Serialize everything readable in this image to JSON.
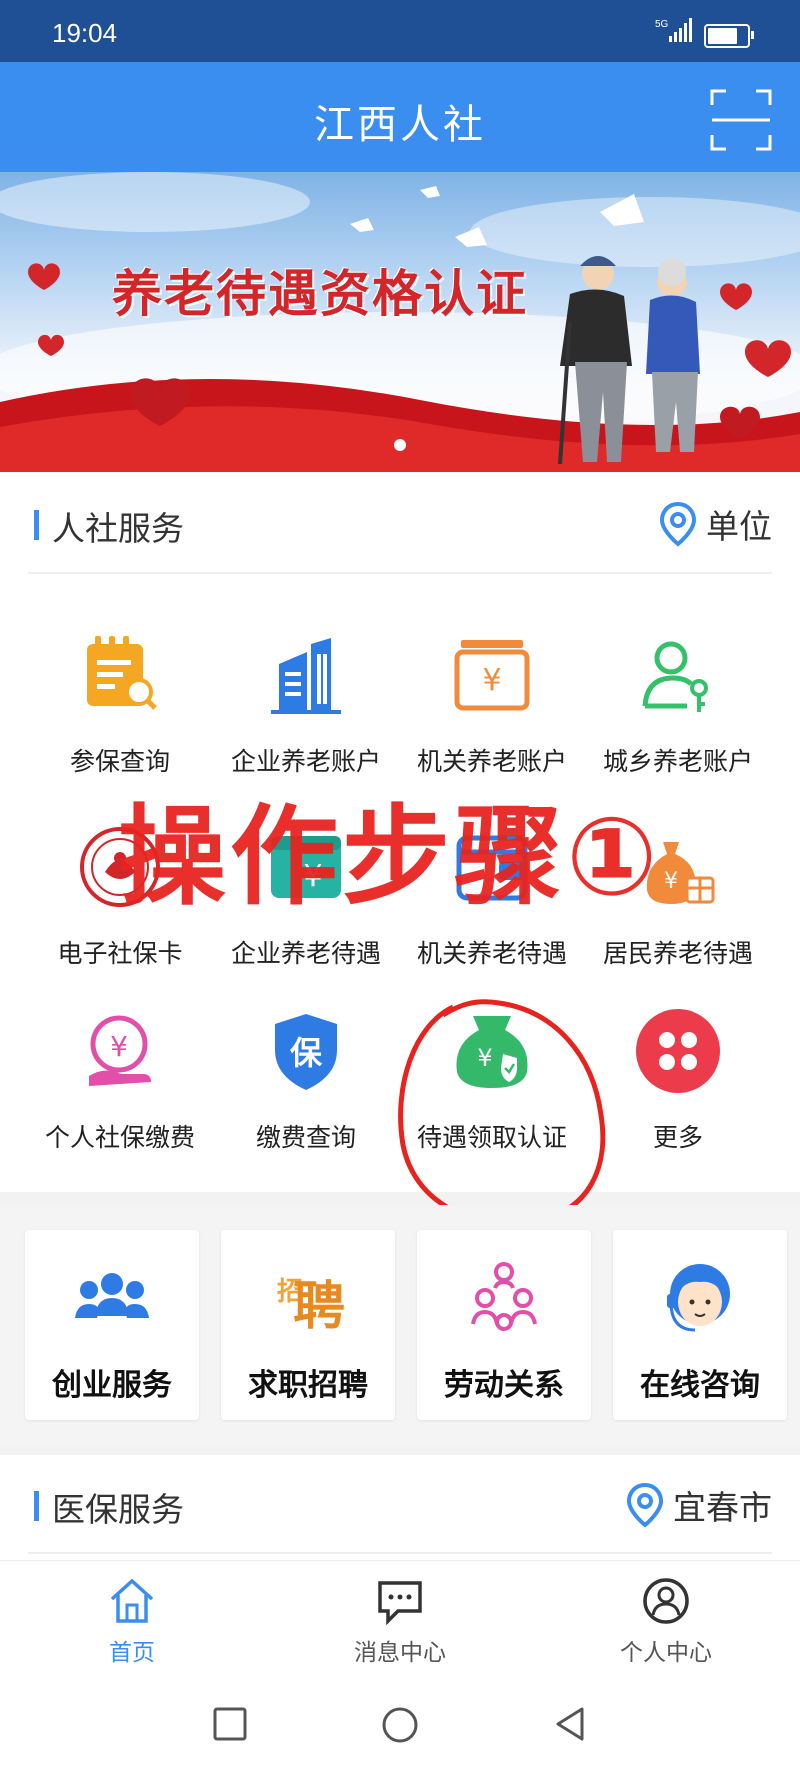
{
  "status_bar": {
    "time": "19:04",
    "network": "5G"
  },
  "header": {
    "title": "江西人社"
  },
  "banner": {
    "headline": "养老待遇资格认证"
  },
  "hr_section": {
    "title": "人社服务",
    "location": "单位",
    "items": [
      {
        "label": "参保查询",
        "icon": "document-search-icon",
        "color": "#f5a623"
      },
      {
        "label": "企业养老账户",
        "icon": "building-icon",
        "color": "#2f7be4"
      },
      {
        "label": "机关养老账户",
        "icon": "yuan-box-icon",
        "color": "#f28a3b"
      },
      {
        "label": "城乡养老账户",
        "icon": "person-key-icon",
        "color": "#34c16a"
      },
      {
        "label": "电子社保卡",
        "icon": "social-security-badge-icon",
        "color": "#d3262b"
      },
      {
        "label": "企业养老待遇",
        "icon": "yuan-wallet-icon",
        "color": "#26b3a3"
      },
      {
        "label": "机关养老待遇",
        "icon": "wallet-icon",
        "color": "#2f7be4"
      },
      {
        "label": "居民养老待遇",
        "icon": "money-bag-gift-icon",
        "color": "#f28a3b"
      },
      {
        "label": "个人社保缴费",
        "icon": "yuan-hand-icon",
        "color": "#e24fa9"
      },
      {
        "label": "缴费查询",
        "icon": "shield-bao-icon",
        "color": "#2f7be4"
      },
      {
        "label": "待遇领取认证",
        "icon": "bag-check-icon",
        "color": "#34b86a"
      },
      {
        "label": "更多",
        "icon": "more-grid-icon",
        "color": "#ec3c4b"
      }
    ]
  },
  "overlay": {
    "text": "操作步骤①"
  },
  "cards": [
    {
      "label": "创业服务",
      "icon": "group-icon"
    },
    {
      "label": "求职招聘",
      "icon": "recruit-icon"
    },
    {
      "label": "劳动关系",
      "icon": "org-chart-icon"
    },
    {
      "label": "在线咨询",
      "icon": "customer-service-icon"
    }
  ],
  "medical_section": {
    "title": "医保服务",
    "location": "宜春市"
  },
  "bottom_nav": [
    {
      "label": "首页",
      "icon": "home-icon",
      "active": true
    },
    {
      "label": "消息中心",
      "icon": "message-icon",
      "active": false
    },
    {
      "label": "个人中心",
      "icon": "user-icon",
      "active": false
    }
  ],
  "colors": {
    "brand": "#3a8ef0",
    "status_bar": "#1f4f95",
    "banner_red": "#d3262b",
    "annotation": "#e8231e"
  }
}
